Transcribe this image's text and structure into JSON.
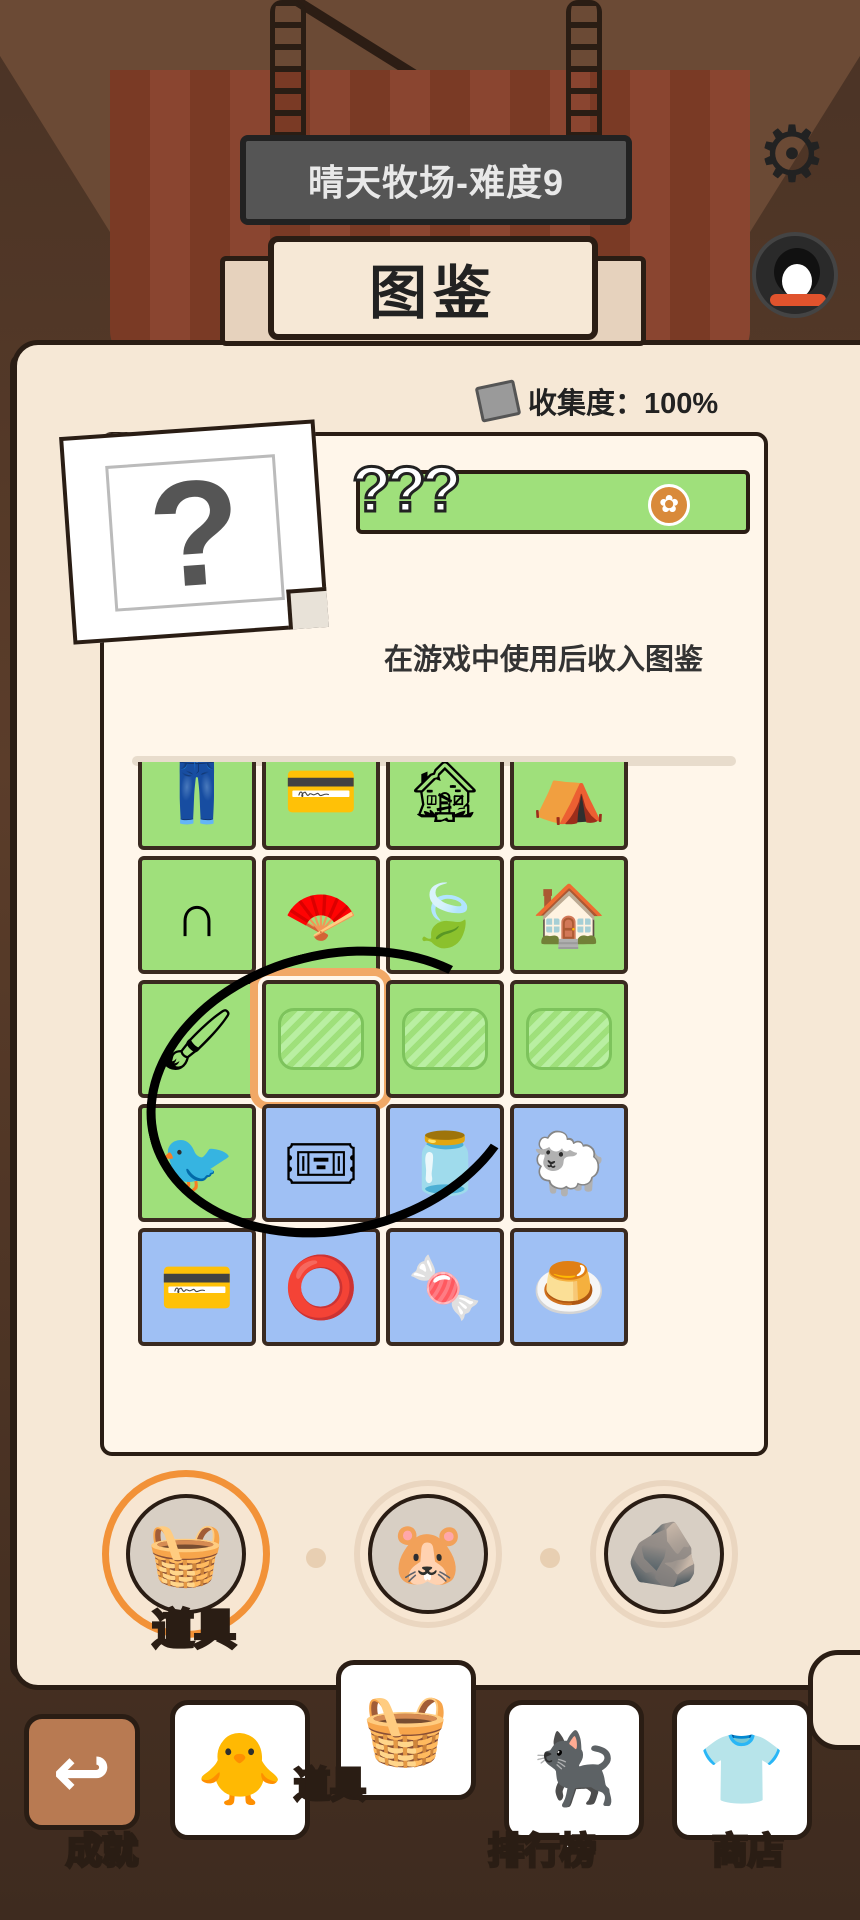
{
  "header": {
    "level_sign": "晴天牧场-难度9",
    "settings_icon": "gear-icon",
    "avatar_icon": "penguin-avatar-icon"
  },
  "book": {
    "title": "图鉴",
    "collection_label": "收集度：100%"
  },
  "detail": {
    "name": "???",
    "description": "在游戏中使用后收入图鉴",
    "placeholder_icon": "question-mark-icon",
    "badge_icon": "coin-icon"
  },
  "grid": {
    "rows": [
      [
        {
          "icon": "overalls-icon",
          "color": "green",
          "glyph": "👖"
        },
        {
          "icon": "card-icon",
          "color": "green",
          "glyph": "💳"
        },
        {
          "icon": "haunted-house-icon",
          "color": "green",
          "glyph": "🏚"
        },
        {
          "icon": "tent-icon",
          "color": "green",
          "glyph": "⛺"
        }
      ],
      [
        {
          "icon": "horseshoe-icon",
          "color": "green",
          "glyph": "∩"
        },
        {
          "icon": "folding-fan-icon",
          "color": "green",
          "glyph": "🪭"
        },
        {
          "icon": "leaf-icon",
          "color": "green",
          "glyph": "🍃"
        },
        {
          "icon": "dog-house-icon",
          "color": "green",
          "glyph": "🏠"
        }
      ],
      [
        {
          "icon": "brush-icon",
          "color": "green",
          "glyph": "🖌"
        },
        {
          "icon": "unknown-item-icon",
          "color": "green",
          "glyph": "",
          "locked": true,
          "selected": true
        },
        {
          "icon": "unknown-item-icon",
          "color": "green",
          "glyph": "",
          "locked": true
        },
        {
          "icon": "unknown-item-icon",
          "color": "green",
          "glyph": "",
          "locked": true
        }
      ],
      [
        {
          "icon": "bird-silhouette-icon",
          "color": "green",
          "glyph": "🐦"
        },
        {
          "icon": "ticket-icon",
          "color": "blue",
          "glyph": "🎟"
        },
        {
          "icon": "jar-icon",
          "color": "blue",
          "glyph": "🫙"
        },
        {
          "icon": "sheep-bubble-icon",
          "color": "blue",
          "glyph": "🐑"
        }
      ],
      [
        {
          "icon": "card-orange-icon",
          "color": "blue",
          "glyph": "💳"
        },
        {
          "icon": "ring-icon",
          "color": "blue",
          "glyph": "⭕"
        },
        {
          "icon": "gumball-machine-icon",
          "color": "blue",
          "glyph": "🍬"
        },
        {
          "icon": "pudding-icon",
          "color": "blue",
          "glyph": "🍮"
        }
      ]
    ]
  },
  "categories": [
    {
      "label": "道具",
      "icon": "picnic-basket-icon",
      "glyph": "🧺",
      "active": true
    },
    {
      "label": "",
      "icon": "hamster-icon",
      "glyph": "🐹",
      "active": false
    },
    {
      "label": "",
      "icon": "rocks-icon",
      "glyph": "🪨",
      "active": false
    }
  ],
  "nav": {
    "back_icon": "back-arrow-icon",
    "items": [
      {
        "label": "成就",
        "icon": "chick-icon",
        "glyph": "🐥"
      },
      {
        "label": "道具",
        "icon": "picnic-basket-icon",
        "glyph": "🧺"
      },
      {
        "label": "排行榜",
        "icon": "black-cat-icon",
        "glyph": "🐈‍⬛"
      },
      {
        "label": "商店",
        "icon": "shirt-icon",
        "glyph": "👕"
      }
    ]
  },
  "colors": {
    "tile_green": "#9fe07b",
    "tile_blue": "#9fc0f4",
    "selected_outline": "#f1a866",
    "active_category_ring": "#f29238"
  }
}
